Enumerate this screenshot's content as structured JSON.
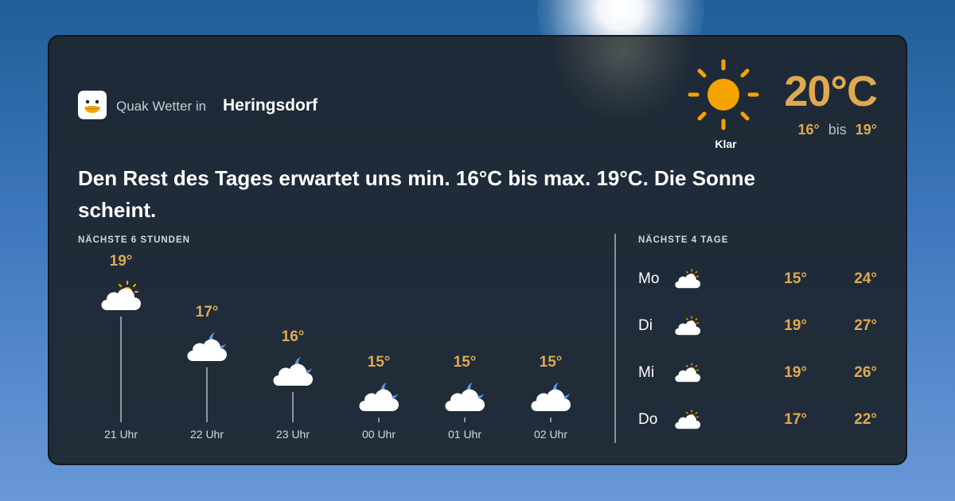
{
  "app": {
    "name": "Quak Wetter in",
    "location": "Heringsdorf"
  },
  "current": {
    "temperature": "20°C",
    "condition": "Klar",
    "min": "16°",
    "range_word": "bis",
    "max": "19°",
    "icon": "sun-icon"
  },
  "summary": "Den Rest des Tages erwartet uns min. 16°C bis max. 19°C. Die Sonne scheint.",
  "hourly": {
    "label": "NÄCHSTE 6 STUNDEN",
    "items": [
      {
        "time": "21 Uhr",
        "temp": "19°",
        "value": 19,
        "icon": "cloud-sun-icon"
      },
      {
        "time": "22 Uhr",
        "temp": "17°",
        "value": 17,
        "icon": "cloud-moon-icon"
      },
      {
        "time": "23 Uhr",
        "temp": "16°",
        "value": 16,
        "icon": "cloud-moon-icon"
      },
      {
        "time": "00 Uhr",
        "temp": "15°",
        "value": 15,
        "icon": "cloud-moon-icon"
      },
      {
        "time": "01 Uhr",
        "temp": "15°",
        "value": 15,
        "icon": "cloud-moon-icon"
      },
      {
        "time": "02 Uhr",
        "temp": "15°",
        "value": 15,
        "icon": "cloud-moon-icon"
      }
    ]
  },
  "daily": {
    "label": "NÄCHSTE 4 TAGE",
    "items": [
      {
        "day": "Mo",
        "min": "15°",
        "max": "24°",
        "icon": "cloud-sun-icon"
      },
      {
        "day": "Di",
        "min": "19°",
        "max": "27°",
        "icon": "cloud-sun-icon"
      },
      {
        "day": "Mi",
        "min": "19°",
        "max": "26°",
        "icon": "cloud-sun-icon"
      },
      {
        "day": "Do",
        "min": "17°",
        "max": "22°",
        "icon": "cloud-sun-icon"
      }
    ]
  },
  "colors": {
    "accent": "#e0a951",
    "card": "#1e2630",
    "sun": "#f5a300",
    "moon": "#5b9cf0"
  }
}
